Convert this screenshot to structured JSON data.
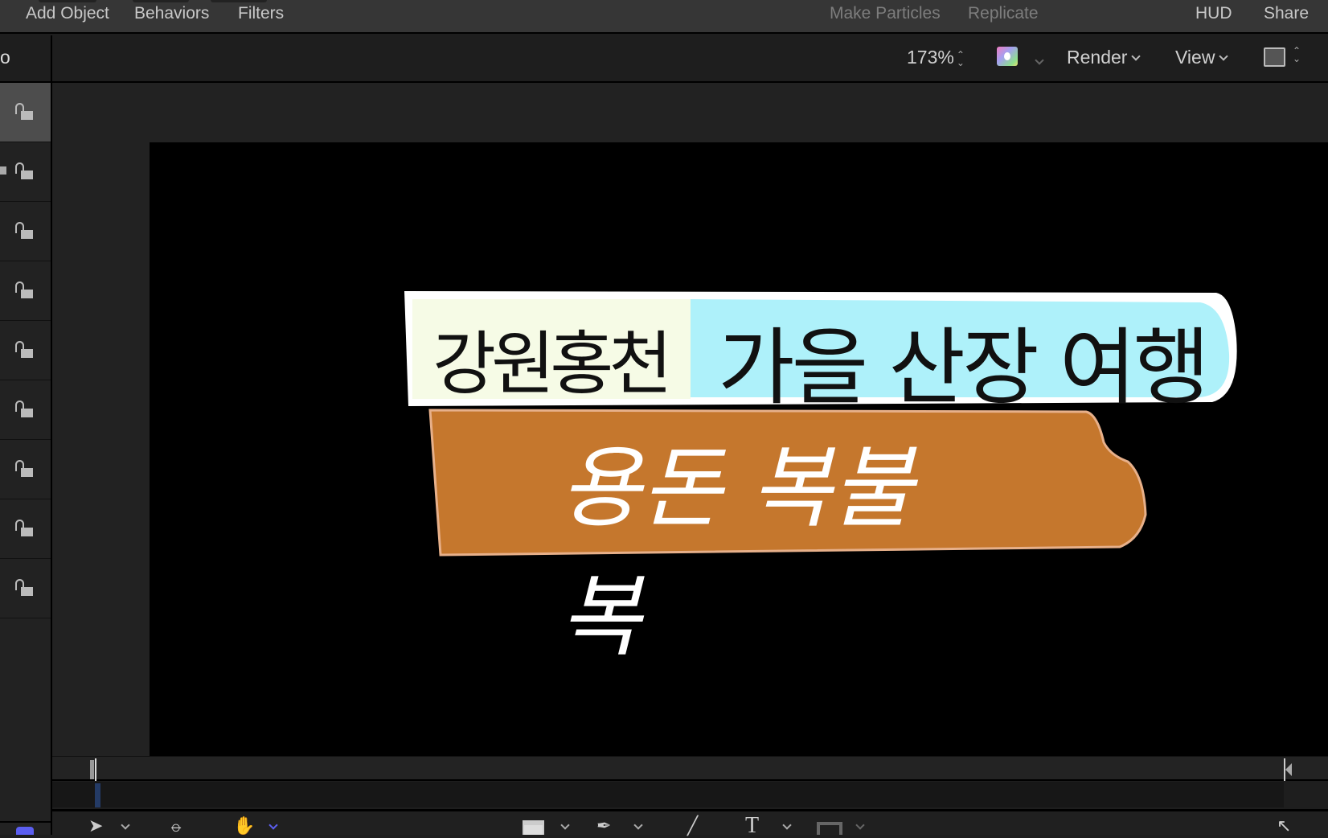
{
  "menubar": {
    "add_object": "Add Object",
    "behaviors": "Behaviors",
    "filters": "Filters",
    "make_particles": "Make Particles",
    "replicate": "Replicate",
    "hud": "HUD",
    "share": "Share"
  },
  "toolbar": {
    "left_label": "o",
    "zoom": "173%",
    "render": "Render",
    "view": "View"
  },
  "canvas": {
    "title_left": "강원홍천",
    "title_right": "가을 산장 여행",
    "subtitle": "용돈 복불복",
    "colors": {
      "cream": "#f6fbe6",
      "cyan": "#aef1fa",
      "orange": "#c5772d",
      "white": "#ffffff"
    }
  },
  "layers": {
    "count": 9,
    "selected_index": 0
  },
  "tools": [
    "select-tool",
    "orbit-tool",
    "hand-tool",
    "rectangle-tool",
    "pen-tool",
    "paint-stroke-tool",
    "text-tool",
    "mask-tool",
    "expand-tool"
  ],
  "accent": "#5b5ef0"
}
